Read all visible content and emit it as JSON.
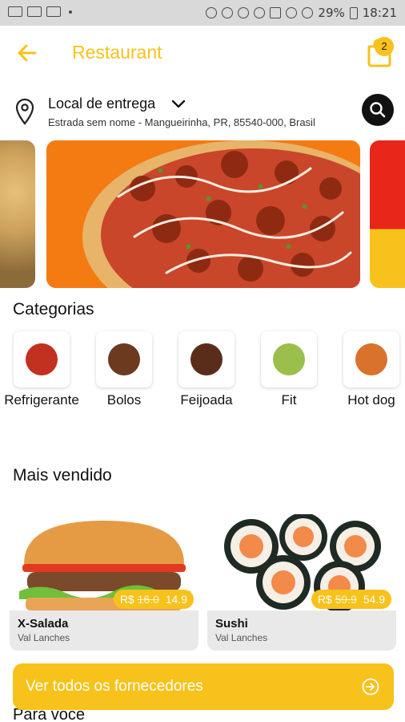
{
  "status_bar": {
    "battery": "29%",
    "time": "18:21"
  },
  "app_bar": {
    "title": "Restaurant",
    "cart_count": "2"
  },
  "location": {
    "label": "Local de entrega",
    "address": "Estrada sem nome - Mangueirinha, PR, 85540-000, Brasil"
  },
  "sections": {
    "categories_title": "Categorias",
    "best_sellers_title": "Mais vendido",
    "for_you_title": "Para voce"
  },
  "categories": [
    {
      "label": "Refrigerante",
      "color": "#c2301f"
    },
    {
      "label": "Bolos",
      "color": "#6b3a1f"
    },
    {
      "label": "Feijoada",
      "color": "#5a2d1a"
    },
    {
      "label": "Fit",
      "color": "#9bbf4c"
    },
    {
      "label": "Hot dog",
      "color": "#d9722b"
    }
  ],
  "products": [
    {
      "name": "X-Salada",
      "store": "Val Lanches",
      "currency": "R$",
      "old_price": "16.0",
      "price": "14.9"
    },
    {
      "name": "Sushi",
      "store": "Val Lanches",
      "currency": "R$",
      "old_price": "59.9",
      "price": "54.9"
    }
  ],
  "cta": {
    "label": "Ver todos os fornecedores"
  },
  "colors": {
    "accent": "#f7c21b",
    "banner_bg": "#f47a12"
  }
}
